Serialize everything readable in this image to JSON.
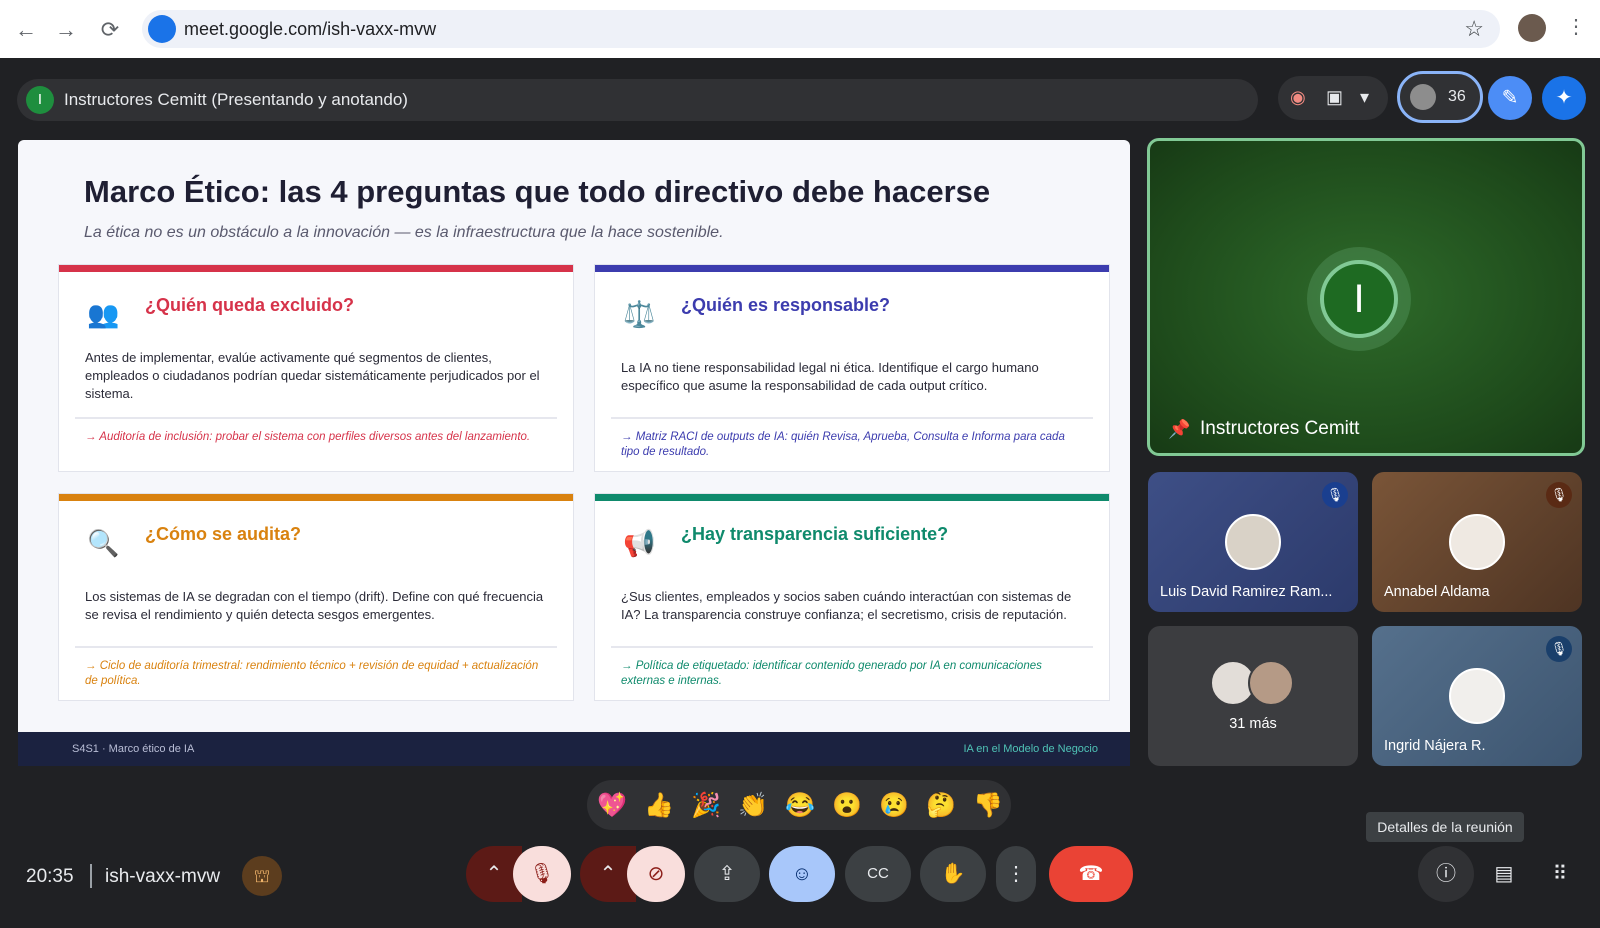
{
  "browser": {
    "url": "meet.google.com/ish-vaxx-mvw",
    "back_icon": "←",
    "forward_icon": "→",
    "reload_icon": "⟳",
    "star_icon": "☆",
    "menu_icon": "⋮"
  },
  "topbar": {
    "presenter_initial": "I",
    "presenter_text": "Instructores Cemitt (Presentando y anotando)",
    "record_icon": "◉",
    "whiteboard_icon": "▣",
    "dropdown_icon": "▾",
    "participant_count": "36",
    "edit_icon": "✎",
    "gemini_icon": "✦"
  },
  "slide": {
    "title": "Marco Ético: las 4 preguntas que todo directivo debe hacerse",
    "subtitle": "La ética no es un obstáculo a la innovación — es la infraestructura que la hace sostenible.",
    "cards": [
      {
        "icon": "👥",
        "title": "¿Quién queda excluido?",
        "body": "Antes de implementar, evalúe activamente qué segmentos de clientes, empleados o ciudadanos podrían quedar sistemáticamente perjudicados por el sistema.",
        "footer": "→ Auditoría de inclusión: probar el sistema con perfiles diversos antes del lanzamiento.",
        "color": "#d6334a"
      },
      {
        "icon": "⚖️",
        "title": "¿Quién es responsable?",
        "body": "La IA no tiene responsabilidad legal ni ética. Identifique el cargo humano específico que asume la responsabilidad de cada output crítico.",
        "footer": "→ Matriz RACI de outputs de IA: quién Revisa, Aprueba, Consulta e Informa para cada tipo de resultado.",
        "color": "#3c3cae"
      },
      {
        "icon": "🔍",
        "title": "¿Cómo se audita?",
        "body": "Los sistemas de IA se degradan con el tiempo (drift). Define con qué frecuencia se revisa el rendimiento y quién detecta sesgos emergentes.",
        "footer": "→ Ciclo de auditoría trimestral: rendimiento técnico + revisión de equidad + actualización de política.",
        "color": "#d9820f"
      },
      {
        "icon": "📢",
        "title": "¿Hay transparencia suficiente?",
        "body": "¿Sus clientes, empleados y socios saben cuándo interactúan con sistemas de IA? La transparencia construye confianza; el secretismo, crisis de reputación.",
        "footer": "→ Política de etiquetado: identificar contenido generado por IA en comunicaciones externas e internas.",
        "color": "#0f8a6c"
      }
    ],
    "footer_left": "S4S1 · Marco ético de IA",
    "footer_right": "IA en el Modelo de Negocio"
  },
  "participants": {
    "main": {
      "initial": "I",
      "name": "Instructores Cemitt",
      "pin_icon": "📌"
    },
    "tiles": [
      {
        "name": "Luis David Ramirez Ram...",
        "muted": true
      },
      {
        "name": "Annabel Aldama",
        "muted": true
      },
      {
        "name": "31 más",
        "muted": false
      },
      {
        "name": "Ingrid Nájera R.",
        "muted": true
      }
    ],
    "mute_icon": "🎙"
  },
  "reactions": [
    "💖",
    "👍",
    "🎉",
    "👏",
    "😂",
    "😮",
    "😢",
    "🤔",
    "👎"
  ],
  "bottombar": {
    "time": "20:35",
    "meeting_code": "ish-vaxx-mvw",
    "host_icon": "⛫",
    "chevron_icon": "⌃",
    "mic_off_icon": "🎙",
    "cam_off_icon": "⊘",
    "present_icon": "⇪",
    "emoji_icon": "☺",
    "captions_icon": "CC",
    "hand_icon": "✋",
    "more_icon": "⋮",
    "hangup_icon": "☎",
    "info_icon": "ⓘ",
    "chat_icon": "▤",
    "apps_icon": "⠿",
    "tooltip": "Detalles de la reunión"
  }
}
